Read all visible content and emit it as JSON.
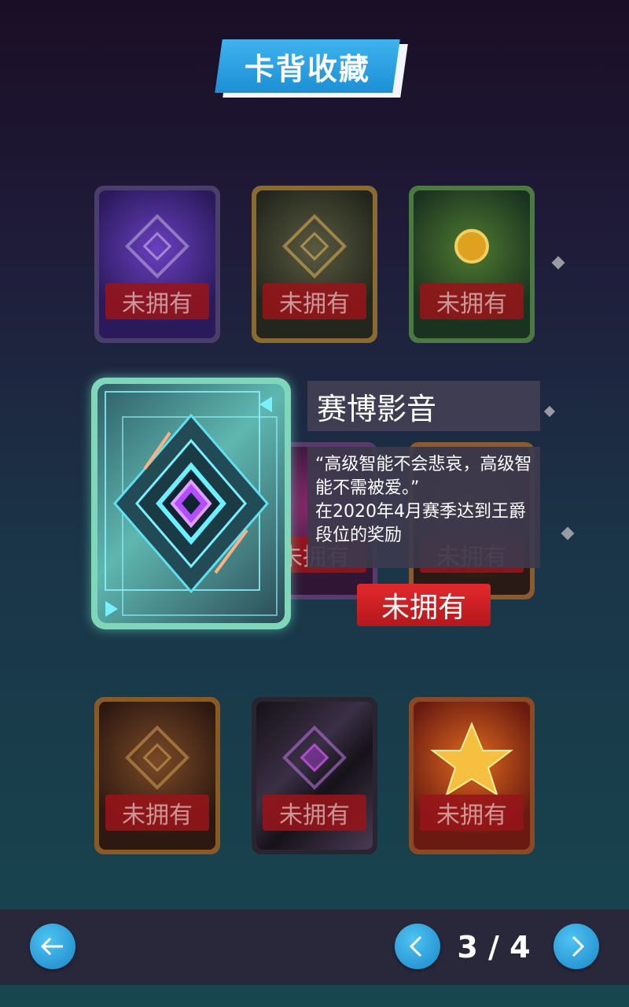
{
  "title": "卡背收藏",
  "cards_top": [
    {
      "status": "未拥有",
      "theme": "purple",
      "frame": "#5a4a7a",
      "bg1": "#2a1a5c",
      "bg2": "#5a2fa0"
    },
    {
      "status": "未拥有",
      "theme": "gold-compass",
      "frame": "#8a6a30",
      "bg1": "#2a2a20",
      "bg2": "#3f4a30"
    },
    {
      "status": "未拥有",
      "theme": "green-laurel",
      "frame": "#4a7a40",
      "bg1": "#1f3a20",
      "bg2": "#3f6a2a"
    }
  ],
  "cards_bottom": [
    {
      "status": "未拥有",
      "theme": "bronze-laurel",
      "frame": "#8a5a25",
      "bg1": "#3a1f15",
      "bg2": "#6a3a20"
    },
    {
      "status": "未拥有",
      "theme": "dark-purple",
      "frame": "#3a3040",
      "bg1": "#151218",
      "bg2": "#4a3a55"
    },
    {
      "status": "未拥有",
      "theme": "red-star",
      "frame": "#8a4a25",
      "bg1": "#6a1a10",
      "bg2": "#c0501a"
    }
  ],
  "selected": {
    "name": "赛博影音",
    "quote": "“高级智能不会悲哀，高级智能不需被爱。”",
    "reward": "在2020年4月赛季达到王爵段位的奖励",
    "status": "未拥有",
    "accent": "#7fd6b8"
  },
  "nav": {
    "page_indicator": "3 / 4",
    "back_icon": "arrow-left-icon",
    "prev_icon": "chevron-left-icon",
    "next_icon": "chevron-right-icon",
    "button_color": "#1f95d8"
  }
}
